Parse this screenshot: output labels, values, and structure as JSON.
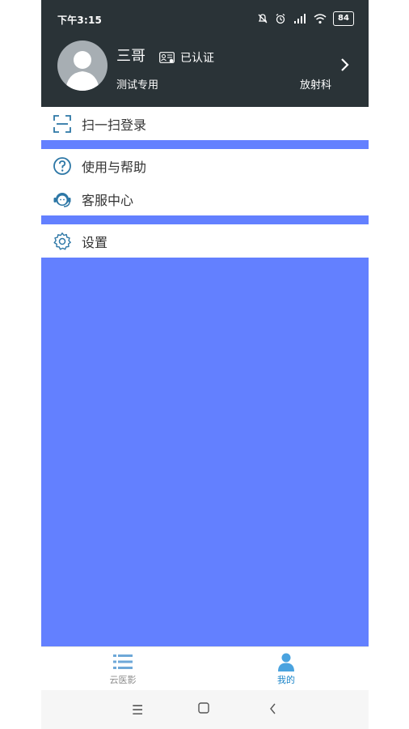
{
  "status_bar": {
    "time": "下午3:15",
    "battery": "84",
    "icons": [
      "mute-icon",
      "alarm-icon",
      "hd-signal-icon",
      "wifi-icon",
      "battery-icon"
    ]
  },
  "profile": {
    "name": "三哥",
    "verified_label": "已认证",
    "department": "测试专用",
    "subject": "放射科"
  },
  "menu": {
    "scan_login": "扫一扫登录",
    "help": "使用与帮助",
    "customer_service": "客服中心",
    "settings": "设置"
  },
  "tabs": [
    {
      "label": "云医影",
      "icon": "list-icon",
      "active": false
    },
    {
      "label": "我的",
      "icon": "person-icon",
      "active": true
    }
  ],
  "colors": {
    "header_bg": "#2a3337",
    "blue_fill": "#6380ff",
    "icon_blue": "#2d77a6",
    "tab_inactive": "#8c8c8c",
    "tab_active": "#1a84c8"
  }
}
